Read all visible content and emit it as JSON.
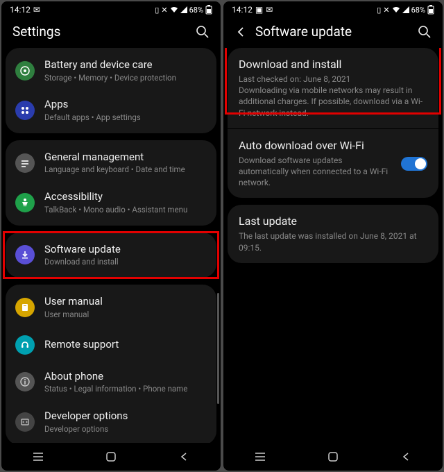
{
  "status": {
    "time": "14:12",
    "battery": "68%"
  },
  "left": {
    "title": "Settings",
    "items": [
      {
        "icon_bg": "#2f7f3f",
        "title": "Battery and device care",
        "sub": "Storage  •  Memory  •  Device protection"
      },
      {
        "icon_bg": "#2a3cad",
        "title": "Apps",
        "sub": "Default apps  •  App settings"
      },
      {
        "icon_bg": "#555",
        "title": "General management",
        "sub": "Language and keyboard  •  Date and time"
      },
      {
        "icon_bg": "#1fa14a",
        "title": "Accessibility",
        "sub": "TalkBack  •  Mono audio  •  Assistant menu"
      },
      {
        "icon_bg": "#5a4fd6",
        "title": "Software update",
        "sub": "Download and install"
      },
      {
        "icon_bg": "#d6a500",
        "title": "User manual",
        "sub": "User manual"
      },
      {
        "icon_bg": "#00a0b0",
        "title": "Remote support",
        "sub": ""
      },
      {
        "icon_bg": "#555",
        "title": "About phone",
        "sub": "Status  •  Legal information  •  Phone name"
      },
      {
        "icon_bg": "#444",
        "title": "Developer options",
        "sub": "Developer options"
      }
    ]
  },
  "right": {
    "title": "Software update",
    "download": {
      "title": "Download and install",
      "line1": "Last checked on: June 8, 2021",
      "line2": "Downloading via mobile networks may result in additional charges. If possible, download via a Wi-Fi network instead."
    },
    "auto": {
      "title": "Auto download over Wi-Fi",
      "sub": "Download software updates automatically when connected to a Wi-Fi network."
    },
    "last": {
      "title": "Last update",
      "sub": "The last update was installed on June 8, 2021 at 09:15."
    }
  }
}
